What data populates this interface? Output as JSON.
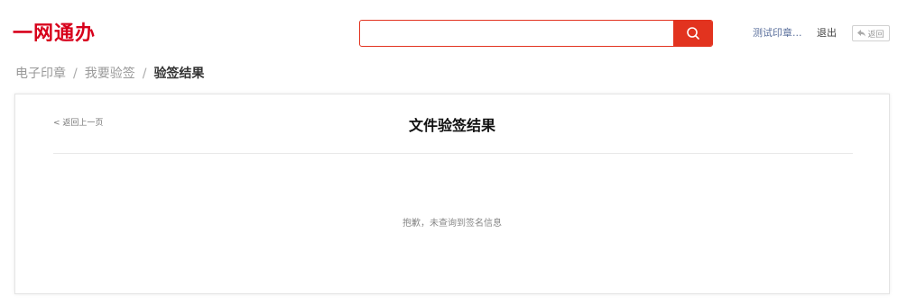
{
  "header": {
    "logo": "一网通办",
    "search": {
      "value": "",
      "placeholder": ""
    },
    "search_icon": "search-icon",
    "user_name": "测试印章...",
    "logout": "退出",
    "back": "返回",
    "back_icon": "reply-arrow-icon"
  },
  "breadcrumb": {
    "items": [
      "电子印章",
      "我要验签"
    ],
    "separator": "/",
    "current": "验签结果"
  },
  "panel": {
    "back_prev": "< 返回上一页",
    "title": "文件验签结果",
    "empty_message": "抱歉，未查询到签名信息"
  },
  "colors": {
    "brand": "#d7001b",
    "search_accent": "#e2331f",
    "link": "#5a6f9c"
  }
}
